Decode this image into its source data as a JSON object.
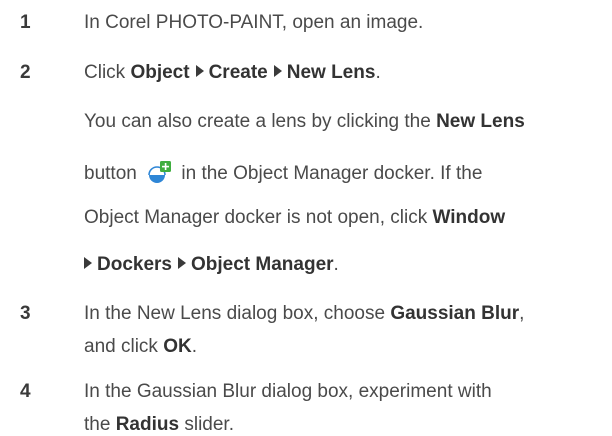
{
  "steps": [
    {
      "number": "1",
      "lines": [
        [
          {
            "t": "In Corel PHOTO-PAINT, open an image.",
            "b": false
          }
        ]
      ]
    },
    {
      "number": "2",
      "lines": [
        [
          {
            "t": "Click ",
            "b": false
          },
          {
            "t": "Object",
            "b": true
          },
          {
            "arrow": true
          },
          {
            "t": "Create",
            "b": true
          },
          {
            "arrow": true
          },
          {
            "t": "New Lens",
            "b": true
          },
          {
            "t": ".",
            "b": false
          }
        ],
        [
          {
            "t": "You can also create a lens by clicking the ",
            "b": false
          },
          {
            "t": "New Lens",
            "b": true
          }
        ],
        [
          {
            "t": "button ",
            "b": false
          },
          {
            "icon": "new-lens-icon"
          },
          {
            "t": " in the Object Manager docker. If the",
            "b": false
          }
        ],
        [
          {
            "t": "Object Manager docker is not open, click ",
            "b": false
          },
          {
            "t": "Window",
            "b": true
          }
        ],
        [
          {
            "arrow": true,
            "lead": true
          },
          {
            "t": "Dockers",
            "b": true
          },
          {
            "arrow": true
          },
          {
            "t": "Object Manager",
            "b": true
          },
          {
            "t": ".",
            "b": false
          }
        ]
      ]
    },
    {
      "number": "3",
      "lines": [
        [
          {
            "t": "In the New Lens dialog box, choose ",
            "b": false
          },
          {
            "t": "Gaussian Blur",
            "b": true
          },
          {
            "t": ",",
            "b": false
          }
        ],
        [
          {
            "t": "and click ",
            "b": false
          },
          {
            "t": "OK",
            "b": true
          },
          {
            "t": ".",
            "b": false
          }
        ]
      ]
    },
    {
      "number": "4",
      "lines": [
        [
          {
            "t": "In the Gaussian Blur dialog box, experiment with",
            "b": false
          }
        ],
        [
          {
            "t": "the ",
            "b": false
          },
          {
            "t": "Radius",
            "b": true
          },
          {
            "t": " slider.",
            "b": false
          }
        ]
      ]
    }
  ]
}
